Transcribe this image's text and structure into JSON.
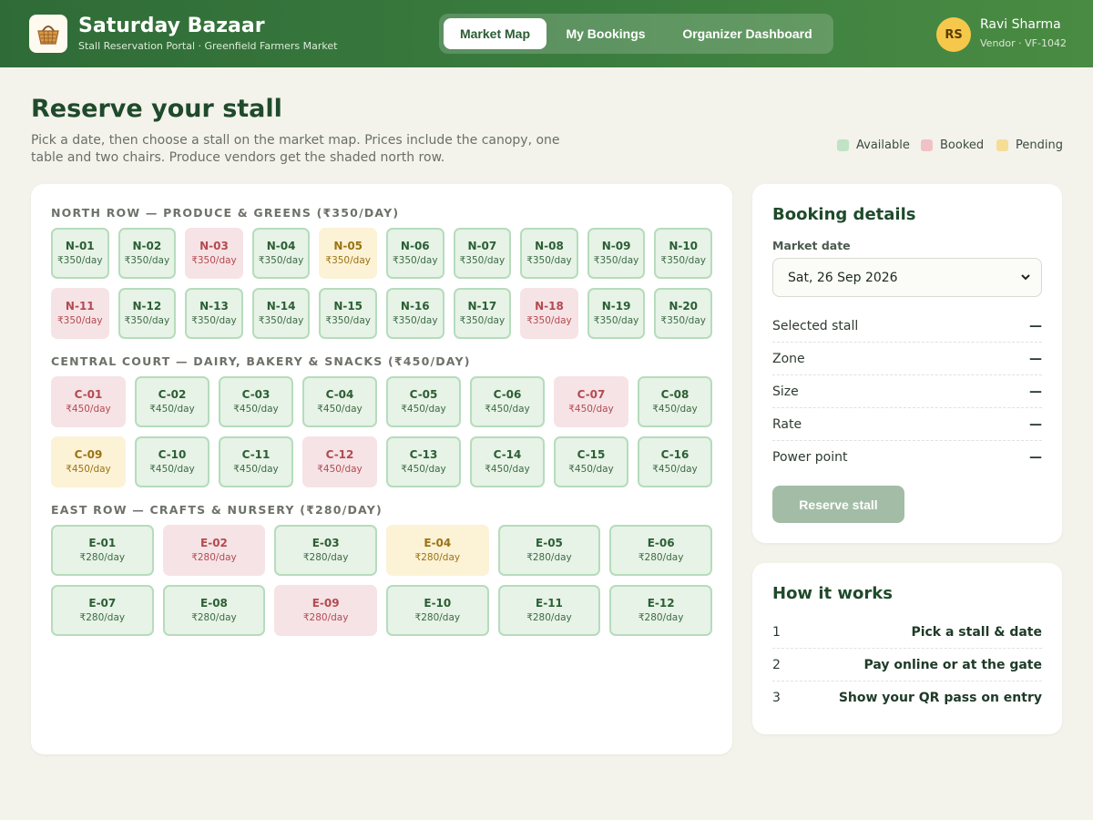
{
  "app": {
    "title": "Saturday Bazaar",
    "subtitle": "Stall Reservation Portal · Greenfield Farmers Market",
    "logo_icon": "basket-icon"
  },
  "nav": {
    "tabs": [
      {
        "label": "Market Map",
        "active": true
      },
      {
        "label": "My Bookings",
        "active": false
      },
      {
        "label": "Organizer Dashboard",
        "active": false
      }
    ]
  },
  "user": {
    "initials": "RS",
    "name": "Ravi Sharma",
    "role": "Vendor · VF-1042"
  },
  "page": {
    "title": "Reserve your stall",
    "description": "Pick a date, then choose a stall on the market map. Prices include the canopy, one table and two chairs. Produce vendors get the shaded north row."
  },
  "legend": [
    {
      "label": "Available",
      "color": "#bfe3c4"
    },
    {
      "label": "Booked",
      "color": "#f0c2c5"
    },
    {
      "label": "Pending",
      "color": "#f6dd96"
    }
  ],
  "zones": [
    {
      "title": "NORTH ROW — PRODUCE & GREENS (₹350/DAY)",
      "rows": [
        [
          {
            "id": "N-01",
            "price": "₹350/day",
            "status": "available"
          },
          {
            "id": "N-02",
            "price": "₹350/day",
            "status": "available"
          },
          {
            "id": "N-03",
            "price": "₹350/day",
            "status": "booked"
          },
          {
            "id": "N-04",
            "price": "₹350/day",
            "status": "available"
          },
          {
            "id": "N-05",
            "price": "₹350/day",
            "status": "pending"
          },
          {
            "id": "N-06",
            "price": "₹350/day",
            "status": "available"
          },
          {
            "id": "N-07",
            "price": "₹350/day",
            "status": "available"
          },
          {
            "id": "N-08",
            "price": "₹350/day",
            "status": "available"
          },
          {
            "id": "N-09",
            "price": "₹350/day",
            "status": "available"
          },
          {
            "id": "N-10",
            "price": "₹350/day",
            "status": "available"
          }
        ],
        [
          {
            "id": "N-11",
            "price": "₹350/day",
            "status": "booked"
          },
          {
            "id": "N-12",
            "price": "₹350/day",
            "status": "available"
          },
          {
            "id": "N-13",
            "price": "₹350/day",
            "status": "available"
          },
          {
            "id": "N-14",
            "price": "₹350/day",
            "status": "available"
          },
          {
            "id": "N-15",
            "price": "₹350/day",
            "status": "available"
          },
          {
            "id": "N-16",
            "price": "₹350/day",
            "status": "available"
          },
          {
            "id": "N-17",
            "price": "₹350/day",
            "status": "available"
          },
          {
            "id": "N-18",
            "price": "₹350/day",
            "status": "booked"
          },
          {
            "id": "N-19",
            "price": "₹350/day",
            "status": "available"
          },
          {
            "id": "N-20",
            "price": "₹350/day",
            "status": "available"
          }
        ]
      ]
    },
    {
      "title": "CENTRAL COURT — DAIRY, BAKERY & SNACKS (₹450/DAY)",
      "rows": [
        [
          {
            "id": "C-01",
            "price": "₹450/day",
            "status": "booked"
          },
          {
            "id": "C-02",
            "price": "₹450/day",
            "status": "available"
          },
          {
            "id": "C-03",
            "price": "₹450/day",
            "status": "available"
          },
          {
            "id": "C-04",
            "price": "₹450/day",
            "status": "available"
          },
          {
            "id": "C-05",
            "price": "₹450/day",
            "status": "available"
          },
          {
            "id": "C-06",
            "price": "₹450/day",
            "status": "available"
          },
          {
            "id": "C-07",
            "price": "₹450/day",
            "status": "booked"
          },
          {
            "id": "C-08",
            "price": "₹450/day",
            "status": "available"
          }
        ],
        [
          {
            "id": "C-09",
            "price": "₹450/day",
            "status": "pending"
          },
          {
            "id": "C-10",
            "price": "₹450/day",
            "status": "available"
          },
          {
            "id": "C-11",
            "price": "₹450/day",
            "status": "available"
          },
          {
            "id": "C-12",
            "price": "₹450/day",
            "status": "booked"
          },
          {
            "id": "C-13",
            "price": "₹450/day",
            "status": "available"
          },
          {
            "id": "C-14",
            "price": "₹450/day",
            "status": "available"
          },
          {
            "id": "C-15",
            "price": "₹450/day",
            "status": "available"
          },
          {
            "id": "C-16",
            "price": "₹450/day",
            "status": "available"
          }
        ]
      ]
    },
    {
      "title": "EAST ROW — CRAFTS & NURSERY (₹280/DAY)",
      "rows": [
        [
          {
            "id": "E-01",
            "price": "₹280/day",
            "status": "available"
          },
          {
            "id": "E-02",
            "price": "₹280/day",
            "status": "booked"
          },
          {
            "id": "E-03",
            "price": "₹280/day",
            "status": "available"
          },
          {
            "id": "E-04",
            "price": "₹280/day",
            "status": "pending"
          },
          {
            "id": "E-05",
            "price": "₹280/day",
            "status": "available"
          },
          {
            "id": "E-06",
            "price": "₹280/day",
            "status": "available"
          }
        ],
        [
          {
            "id": "E-07",
            "price": "₹280/day",
            "status": "available"
          },
          {
            "id": "E-08",
            "price": "₹280/day",
            "status": "available"
          },
          {
            "id": "E-09",
            "price": "₹280/day",
            "status": "booked"
          },
          {
            "id": "E-10",
            "price": "₹280/day",
            "status": "available"
          },
          {
            "id": "E-11",
            "price": "₹280/day",
            "status": "available"
          },
          {
            "id": "E-12",
            "price": "₹280/day",
            "status": "available"
          }
        ]
      ]
    }
  ],
  "booking": {
    "title": "Booking details",
    "date_label": "Market date",
    "date_value": "Sat, 26 Sep 2026",
    "rows": [
      {
        "label": "Selected stall",
        "value": "—"
      },
      {
        "label": "Zone",
        "value": "—"
      },
      {
        "label": "Size",
        "value": "—"
      },
      {
        "label": "Rate",
        "value": "—"
      },
      {
        "label": "Power point",
        "value": "—"
      }
    ],
    "button_label": "Reserve stall"
  },
  "how_it_works": {
    "title": "How it works",
    "steps": [
      {
        "num": "1",
        "text": "Pick a stall & date"
      },
      {
        "num": "2",
        "text": "Pay online or at the gate"
      },
      {
        "num": "3",
        "text": "Show your QR pass on entry"
      }
    ]
  }
}
